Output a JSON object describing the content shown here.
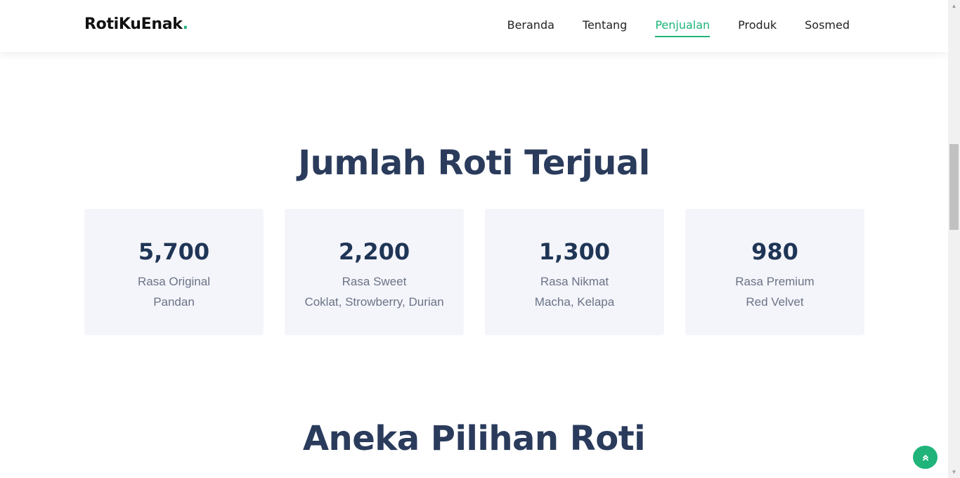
{
  "header": {
    "logo_text": "RotiKuEnak",
    "logo_dot": ".",
    "nav": [
      {
        "label": "Beranda"
      },
      {
        "label": "Tentang"
      },
      {
        "label": "Penjualan"
      },
      {
        "label": "Produk"
      },
      {
        "label": "Sosmed"
      }
    ],
    "active_nav": "Penjualan"
  },
  "sales_section": {
    "title": "Jumlah Roti Terjual",
    "cards": [
      {
        "value": "5,700",
        "label": "Rasa Original",
        "sub": "Pandan"
      },
      {
        "value": "2,200",
        "label": "Rasa Sweet",
        "sub": "Coklat, Strowberry, Durian"
      },
      {
        "value": "1,300",
        "label": "Rasa Nikmat",
        "sub": "Macha, Kelapa"
      },
      {
        "value": "980",
        "label": "Rasa Premium",
        "sub": "Red Velvet"
      }
    ]
  },
  "products_section": {
    "title": "Aneka Pilihan Roti"
  },
  "colors": {
    "accent": "#20b37a",
    "heading": "#2a3b5c",
    "card_bg": "#f4f5fa"
  },
  "icons": {
    "back_to_top": "double-chevron-up-icon"
  }
}
